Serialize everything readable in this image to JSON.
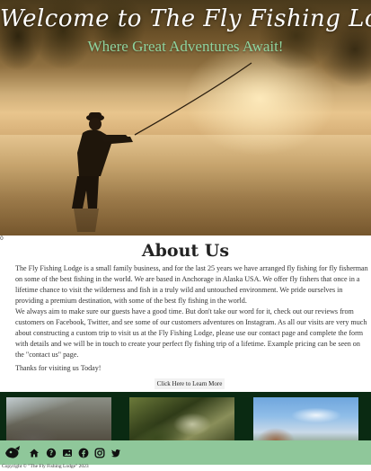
{
  "hero": {
    "title": "Welcome to The Fly Fishing Lodge",
    "subtitle": "Where Great Adventures Await!",
    "marker": "0"
  },
  "about": {
    "heading": "About Us",
    "paragraphs": [
      "The Fly Fishing Lodge is a small family business, and for the last 25 years we have arranged fly fishing for fly fisherman on some of the best fishing in the world. We are based in Anchorage in Alaska USA. We offer fly fishers that once in a lifetime chance to visit the wilderness and fish in a truly wild and untouched environment. We pride ourselves in providing a premium destination, with some of the best fly fishing in the world.",
      "We always aim to make sure our guests have a good time. But don't take our word for it, check out our reviews from customers on Facebook, Twitter, and see some of our customers adventures on Instagram. As all our visits are very much about constructing a custom trip to visit us at the Fly Fishing Lodge, please use our contact page and complete the form with details and we will be in touch to create your perfect fly fishing trip of a lifetime. Example pricing can be seen on the \"contact us\" page.",
      "Thanks for visiting us Today!"
    ],
    "button_label": "Click Here to Learn More"
  },
  "gallery": {
    "images": [
      "fishing-scene-1",
      "fishing-scene-2",
      "fishing-scene-3"
    ]
  },
  "footer": {
    "icons": [
      "home-icon",
      "help-icon",
      "gallery-icon",
      "facebook-icon",
      "instagram-icon",
      "twitter-icon"
    ],
    "copyright": "Copyright © \"The Fly Fishing Lodge\" 2023"
  },
  "colors": {
    "accent_green": "#8fc79a",
    "gallery_bg": "#0a2a12",
    "subtitle_green": "#8fd39e"
  }
}
